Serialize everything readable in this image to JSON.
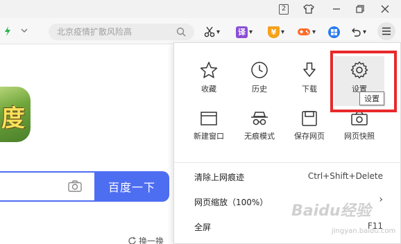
{
  "titlebar": {
    "tab_count": "2"
  },
  "toolbar": {
    "search_placeholder": "北京疫情扩散风险高",
    "translate_label": "译",
    "coupon_label": "¥",
    "colors": {
      "accent": "#27b24a",
      "translate": "#8a4fd6",
      "coupon": "#f5a21b",
      "game": "#ff6a2b",
      "apps": "#2b7cf0"
    }
  },
  "page": {
    "logo_char": "度",
    "search_button": "百度一下",
    "refresh_label": "换一换",
    "brand_color": "#4e6ef2"
  },
  "menu": {
    "grid": [
      {
        "label": "收藏",
        "icon": "star-icon"
      },
      {
        "label": "历史",
        "icon": "clock-icon"
      },
      {
        "label": "下载",
        "icon": "download-icon"
      },
      {
        "label": "设置",
        "icon": "gear-icon"
      },
      {
        "label": "新建窗口",
        "icon": "new-window-icon"
      },
      {
        "label": "无痕模式",
        "icon": "incognito-icon"
      },
      {
        "label": "保存网页",
        "icon": "save-icon"
      },
      {
        "label": "网页快照",
        "icon": "camera-icon"
      }
    ],
    "tooltip": "设置",
    "list": [
      {
        "label": "清除上网痕迹",
        "right": "Ctrl+Shift+Delete"
      },
      {
        "label": "网页缩放（100%）",
        "right": "›"
      },
      {
        "label": "全屏",
        "right": "F11"
      }
    ],
    "highlight_color": "#e8292b"
  },
  "watermark": {
    "main": "Baidu经验",
    "sub": "jingyan.baidu.com"
  }
}
